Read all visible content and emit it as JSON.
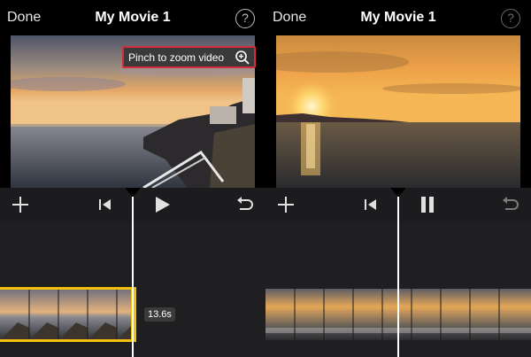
{
  "left": {
    "done_label": "Done",
    "title": "My Movie 1",
    "help_label": "?",
    "zoom_hint": "Pinch to zoom video",
    "duration": "13.6s",
    "state": "paused"
  },
  "right": {
    "done_label": "Done",
    "title": "My Movie 1",
    "help_label": "?",
    "state": "playing"
  },
  "icons": {
    "add": "plus-icon",
    "skip_back": "skip-to-start-icon",
    "play": "play-icon",
    "pause": "pause-icon",
    "undo": "undo-icon",
    "zoom": "magnifier-plus-icon",
    "help": "question-icon"
  },
  "colors": {
    "accent_clip": "#f3c10c",
    "hint_border": "#d62a3a",
    "control_bar": "#1c1c1e",
    "timeline_bg": "#1f1f21"
  }
}
